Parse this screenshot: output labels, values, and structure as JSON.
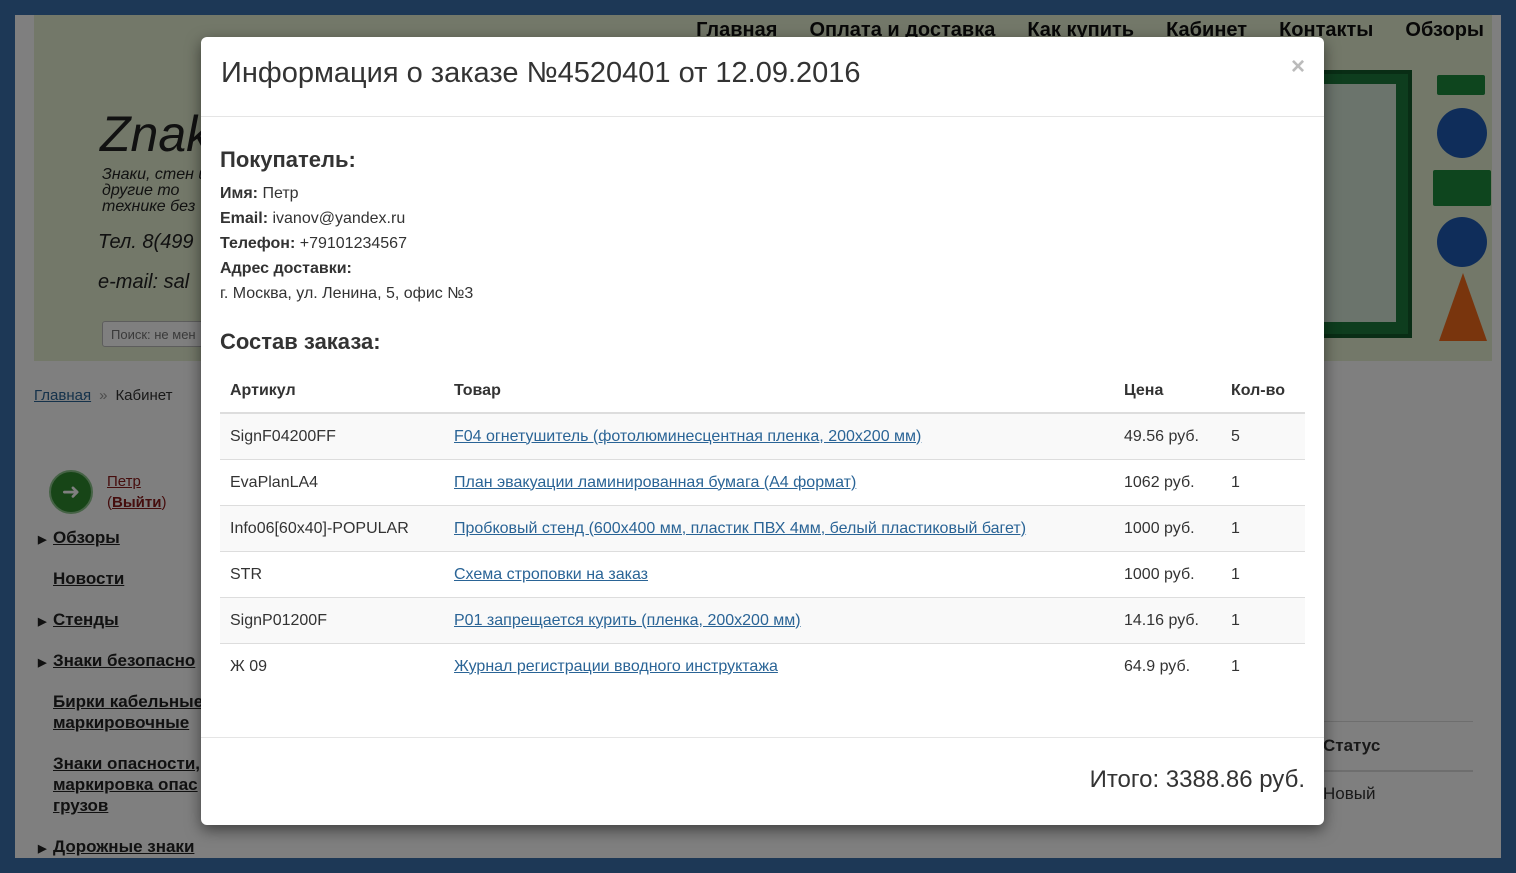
{
  "site": {
    "nav": [
      "Главная",
      "Оплата и доставка",
      "Как купить",
      "Кабинет",
      "Контакты",
      "Обзоры"
    ],
    "logo": "Znak",
    "tagline": "Знаки, стен и другие то технике без",
    "phone": "Тел. 8(499",
    "email": "e-mail: sal",
    "search_placeholder": "Поиск: не мен",
    "breadcrumb": {
      "home": "Главная",
      "separator": "»",
      "current": "Кабинет"
    },
    "user": {
      "name": "Петр",
      "logout": "Выйти"
    },
    "sidemenu": [
      {
        "label": "Обзоры",
        "arrow": true
      },
      {
        "label": "Новости",
        "arrow": false
      },
      {
        "label": "Стенды",
        "arrow": true
      },
      {
        "label": "Знаки безопасно",
        "arrow": true
      },
      {
        "label": "Бирки кабельные маркировочные",
        "arrow": false
      },
      {
        "label": "Знаки опасности, маркировка опас грузов",
        "arrow": false
      },
      {
        "label": "Дорожные знаки",
        "arrow": true
      }
    ],
    "side_table": {
      "header": "Статус",
      "value": "Новый"
    }
  },
  "modal": {
    "title": "Информация о заказе №4520401 от 12.09.2016",
    "close": "×",
    "buyer_heading": "Покупатель:",
    "fields": {
      "name_label": "Имя:",
      "name": "Петр",
      "email_label": "Email:",
      "email": "ivanov@yandex.ru",
      "phone_label": "Телефон:",
      "phone": "+79101234567",
      "address_label": "Адрес доставки:",
      "address": "г. Москва, ул. Ленина, 5, офис №3"
    },
    "order_heading": "Состав заказа:",
    "columns": [
      "Артикул",
      "Товар",
      "Цена",
      "Кол-во"
    ],
    "items": [
      {
        "sku": "SignF04200FF",
        "product": "F04 огнетушитель (фотолюминесцентная пленка, 200x200 мм)",
        "price": "49.56 руб.",
        "qty": "5"
      },
      {
        "sku": "EvaPlanLA4",
        "product": "План эвакуации ламинированная бумага (А4 формат)",
        "price": "1062 руб.",
        "qty": "1"
      },
      {
        "sku": "Info06[60x40]-POPULAR",
        "product": "Пробковый стенд (600x400 мм, пластик ПВХ 4мм, белый пластиковый багет)",
        "price": "1000 руб.",
        "qty": "1"
      },
      {
        "sku": "STR",
        "product": "Схема строповки на заказ",
        "price": "1000 руб.",
        "qty": "1"
      },
      {
        "sku": "SignP01200F",
        "product": "P01 запрещается курить (пленка, 200x200 мм)",
        "price": "14.16 руб.",
        "qty": "1"
      },
      {
        "sku": "Ж 09",
        "product": "Журнал регистрации вводного инструктажа",
        "price": "64.9 руб.",
        "qty": "1"
      }
    ],
    "total": "Итого: 3388.86 руб."
  }
}
